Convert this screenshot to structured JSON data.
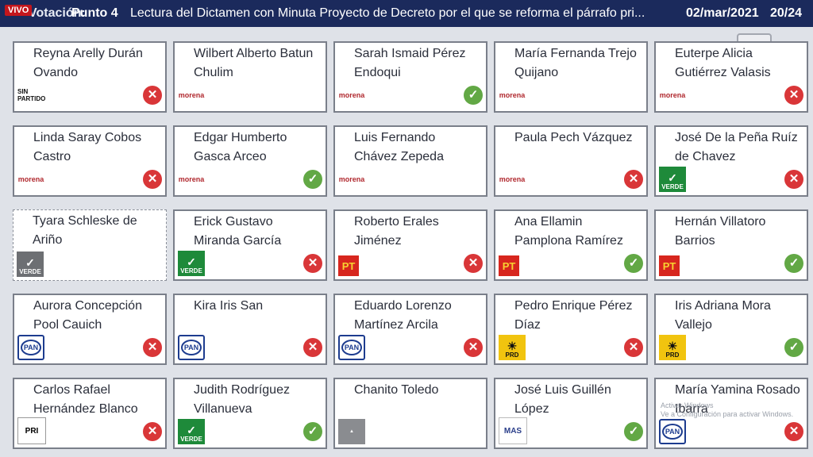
{
  "header": {
    "live_badge": "VIVO",
    "section": "Votación:",
    "point": "Punto 4",
    "title": "Lectura del Dictamen con Minuta Proyecto de Decreto por el que se reforma el párrafo pri...",
    "date": "02/mar/2021",
    "page": "20/24"
  },
  "watermark": {
    "line1": "Activar Windows",
    "line2": "Ve a Configuración para activar Windows."
  },
  "colors": {
    "header_bg": "#1b2a5c",
    "vote_no": "#d93638",
    "vote_yes": "#62a845"
  },
  "legislators": [
    {
      "name": "Reyna Arelly Durán Ovando",
      "party": "sin-partido",
      "party_label": "SIN PARTIDO",
      "vote": "no",
      "vote_icon": "cross-icon"
    },
    {
      "name": "Wilbert Alberto Batun Chulim",
      "party": "morena",
      "party_label": "morena",
      "vote": "none",
      "vote_icon": ""
    },
    {
      "name": "Sarah Ismaid Pérez Endoqui",
      "party": "morena",
      "party_label": "morena",
      "vote": "yes",
      "vote_icon": "check-icon"
    },
    {
      "name": "María Fernanda Trejo Quijano",
      "party": "morena",
      "party_label": "morena",
      "vote": "none",
      "vote_icon": ""
    },
    {
      "name": "Euterpe Alicia Gutiérrez Valasis",
      "party": "morena",
      "party_label": "morena",
      "vote": "no",
      "vote_icon": "cross-icon"
    },
    {
      "name": "Linda Saray Cobos Castro",
      "party": "morena",
      "party_label": "morena",
      "vote": "no",
      "vote_icon": "cross-icon"
    },
    {
      "name": "Edgar Humberto Gasca Arceo",
      "party": "morena",
      "party_label": "morena",
      "vote": "yes",
      "vote_icon": "check-icon"
    },
    {
      "name": "Luis Fernando Chávez Zepeda",
      "party": "morena",
      "party_label": "morena",
      "vote": "none",
      "vote_icon": ""
    },
    {
      "name": "Paula Pech Vázquez",
      "party": "morena",
      "party_label": "morena",
      "vote": "no",
      "vote_icon": "cross-icon"
    },
    {
      "name": "José De la Peña Ruíz de Chavez",
      "party": "verde",
      "party_label": "VERDE",
      "vote": "no",
      "vote_icon": "cross-icon"
    },
    {
      "name": "Tyara Schleske de Ariño",
      "party": "verde-gray",
      "party_label": "VERDE",
      "vote": "absent",
      "vote_icon": ""
    },
    {
      "name": "Erick Gustavo Miranda García",
      "party": "verde",
      "party_label": "VERDE",
      "vote": "no",
      "vote_icon": "cross-icon"
    },
    {
      "name": "Roberto Erales Jiménez",
      "party": "pt",
      "party_label": "PT",
      "vote": "no",
      "vote_icon": "cross-icon"
    },
    {
      "name": "Ana Ellamin Pamplona Ramírez",
      "party": "pt",
      "party_label": "PT",
      "vote": "yes",
      "vote_icon": "check-icon"
    },
    {
      "name": "Hernán Villatoro Barrios",
      "party": "pt",
      "party_label": "PT",
      "vote": "yes",
      "vote_icon": "check-icon"
    },
    {
      "name": "Aurora Concepción Pool Cauich",
      "party": "pan",
      "party_label": "PAN",
      "vote": "no",
      "vote_icon": "cross-icon"
    },
    {
      "name": "Kira Iris San",
      "party": "pan",
      "party_label": "PAN",
      "vote": "no",
      "vote_icon": "cross-icon"
    },
    {
      "name": "Eduardo Lorenzo Martínez Arcila",
      "party": "pan",
      "party_label": "PAN",
      "vote": "no",
      "vote_icon": "cross-icon"
    },
    {
      "name": "Pedro Enrique Pérez Díaz",
      "party": "prd",
      "party_label": "PRD",
      "vote": "no",
      "vote_icon": "cross-icon"
    },
    {
      "name": "Iris Adriana Mora Vallejo",
      "party": "prd",
      "party_label": "PRD",
      "vote": "yes",
      "vote_icon": "check-icon"
    },
    {
      "name": "Carlos Rafael Hernández Blanco",
      "party": "pri",
      "party_label": "PRI",
      "vote": "no",
      "vote_icon": "cross-icon"
    },
    {
      "name": "Judith Rodríguez Villanueva",
      "party": "verde",
      "party_label": "VERDE",
      "vote": "yes",
      "vote_icon": "check-icon"
    },
    {
      "name": "Chanito Toledo",
      "party": "cf",
      "party_label": "",
      "vote": "none",
      "vote_icon": ""
    },
    {
      "name": "José Luis Guillén López",
      "party": "mas",
      "party_label": "MAS",
      "vote": "yes",
      "vote_icon": "check-icon"
    },
    {
      "name": "María Yamina Rosado Ibarra",
      "party": "pan",
      "party_label": "PAN",
      "vote": "no",
      "vote_icon": "cross-icon"
    }
  ]
}
